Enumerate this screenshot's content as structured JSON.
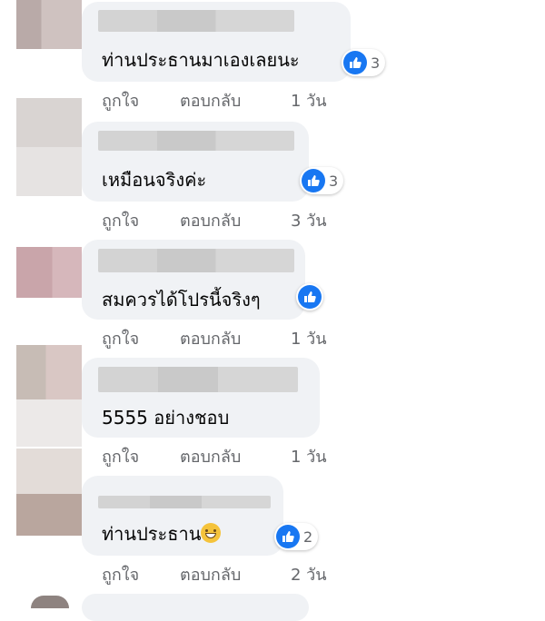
{
  "actions": {
    "like": "ถูกใจ",
    "reply": "ตอบกลับ"
  },
  "comments": [
    {
      "text": "ท่านประธานมาเองเลยนะ",
      "reactions": "3",
      "time": "1 วัน"
    },
    {
      "text": "เหมือนจริงค่ะ",
      "reactions": "3",
      "time": "3 วัน"
    },
    {
      "text": "สมควรได้โปรนี้จริงๆ",
      "reactions": "",
      "time": "1 วัน"
    },
    {
      "text": "5555 อย่างชอบ",
      "reactions": "",
      "time": "1 วัน"
    },
    {
      "text": "ท่านประธาน",
      "reactions": "2",
      "time": "2 วัน"
    }
  ],
  "icons": {
    "reaction": "thumbs-up-icon",
    "emoji": "grinning-face-icon"
  },
  "colors": {
    "like_blue": "#1877f2",
    "bubble": "#f0f2f5",
    "meta": "#65676b"
  }
}
